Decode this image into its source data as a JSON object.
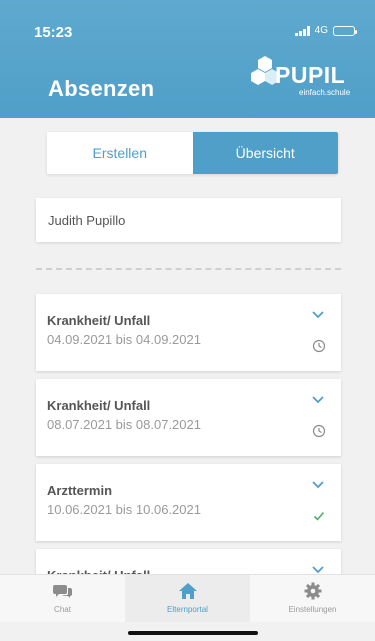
{
  "status_bar": {
    "time": "15:23",
    "network": "4G"
  },
  "header": {
    "title": "Absenzen",
    "logo_text": "PUPIL",
    "logo_subtitle": "einfach.schule"
  },
  "segmented": {
    "create_label": "Erstellen",
    "overview_label": "Übersicht",
    "selected": "Übersicht"
  },
  "child_select": {
    "value": "Judith Pupillo"
  },
  "absences": [
    {
      "type": "Krankheit/ Unfall",
      "dates": "04.09.2021 bis 04.09.2021",
      "status_icon": "clock-icon"
    },
    {
      "type": "Krankheit/ Unfall",
      "dates": "08.07.2021 bis 08.07.2021",
      "status_icon": "clock-icon"
    },
    {
      "type": "Arzttermin",
      "dates": "10.06.2021 bis 10.06.2021",
      "status_icon": "check-icon"
    },
    {
      "type": "Krankheit/ Unfall",
      "dates": "",
      "status_icon": ""
    }
  ],
  "tabbar": {
    "chat_label": "Chat",
    "portal_label": "Elternportal",
    "settings_label": "Einstellungen",
    "active": "Elternportal"
  },
  "colors": {
    "primary": "#4f9fc8",
    "header": "#5fa9cf",
    "check": "#4cae6e",
    "background": "#f1f1f1"
  }
}
